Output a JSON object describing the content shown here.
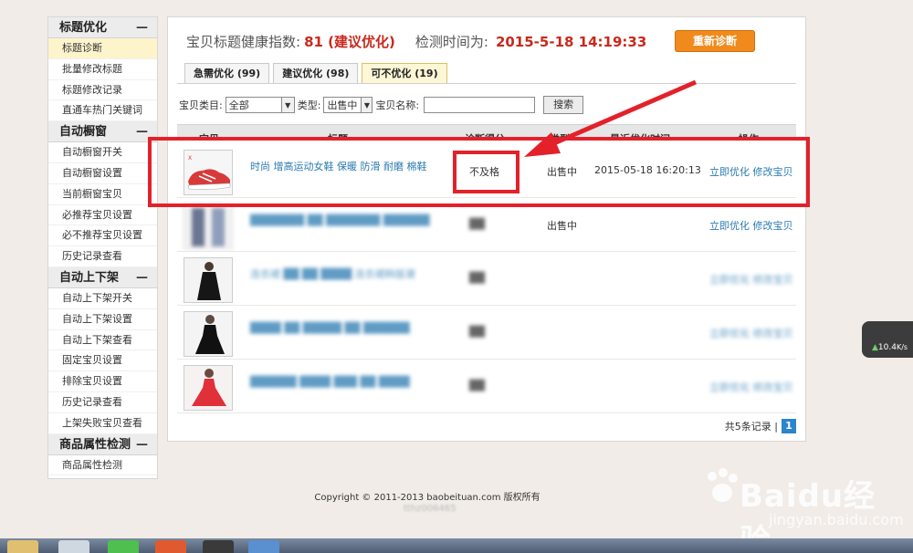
{
  "sidebar": {
    "sections": [
      {
        "title": "标题优化",
        "toggle": "—",
        "items": [
          "标题诊断",
          "批量修改标题",
          "标题修改记录",
          "直通车热门关键词"
        ]
      },
      {
        "title": "自动橱窗",
        "toggle": "—",
        "items": [
          "自动橱窗开关",
          "自动橱窗设置",
          "当前橱窗宝贝",
          "必推荐宝贝设置",
          "必不推荐宝贝设置",
          "历史记录查看"
        ]
      },
      {
        "title": "自动上下架",
        "toggle": "—",
        "items": [
          "自动上下架开关",
          "自动上下架设置",
          "自动上下架查看",
          "固定宝贝设置",
          "排除宝贝设置",
          "历史记录查看",
          "上架失败宝贝查看"
        ]
      },
      {
        "title": "商品属性检测",
        "toggle": "—",
        "items": [
          "商品属性检测"
        ]
      }
    ]
  },
  "header": {
    "health_label": "宝贝标题健康指数:",
    "health_score": "81 (建议优化)",
    "time_label": "检测时间为:",
    "time_value": "2015-5-18 14:19:33",
    "rediagnose": "重新诊断"
  },
  "tabs": [
    {
      "label": "急需优化 (99)"
    },
    {
      "label": "建议优化 (98)"
    },
    {
      "label": "可不优化 (19)"
    }
  ],
  "filters": {
    "category_label": "宝贝类目:",
    "category_value": "全部",
    "type_label": "类型:",
    "type_value": "出售中",
    "name_label": "宝贝名称:",
    "search_label": "搜索"
  },
  "table": {
    "headers": [
      "宝贝",
      "标题",
      "诊断得分",
      "类型",
      "最近优化时间",
      "操作"
    ],
    "rows": [
      {
        "title": "时尚 增高运动女鞋 保暖 防滑 耐磨 棉鞋",
        "score": "不及格",
        "status": "出售中",
        "time": "2015-05-18 16:20:13",
        "op1": "立即优化",
        "op2": "修改宝贝"
      },
      {
        "title": "███████ ██ ███████ ██████",
        "score": "██",
        "status": "出售中",
        "time": "",
        "op1": "立即优化",
        "op2": "修改宝贝"
      },
      {
        "title": "连衣裙 ██ ██ ████ 连衣裙韩版潮",
        "score": "██",
        "status": "",
        "time": "",
        "op1": "立即优化",
        "op2": "修改宝贝"
      },
      {
        "title": "████ ██ █████ ██ ██████",
        "score": "██",
        "status": "",
        "time": "",
        "op1": "立即优化",
        "op2": "修改宝贝"
      },
      {
        "title": "██████ ████ ███ ██ ████",
        "score": "██",
        "status": "",
        "time": "",
        "op1": "立即优化",
        "op2": "修改宝贝"
      }
    ]
  },
  "pager": {
    "total": "共5条记录 |",
    "page": "1"
  },
  "footer": {
    "copyright": "Copyright © 2011-2013 baobeituan.com 版权所有",
    "code": "tthz006465"
  },
  "speed": {
    "value": "10.4",
    "unit": "K/s"
  },
  "watermark": {
    "brand": "Baidu经验",
    "url": "jingyan.baidu.com"
  },
  "colors": {
    "accent": "#c8291c",
    "button": "#f08a1c",
    "link": "#2a7ab0",
    "annotation": "#e3212b"
  }
}
